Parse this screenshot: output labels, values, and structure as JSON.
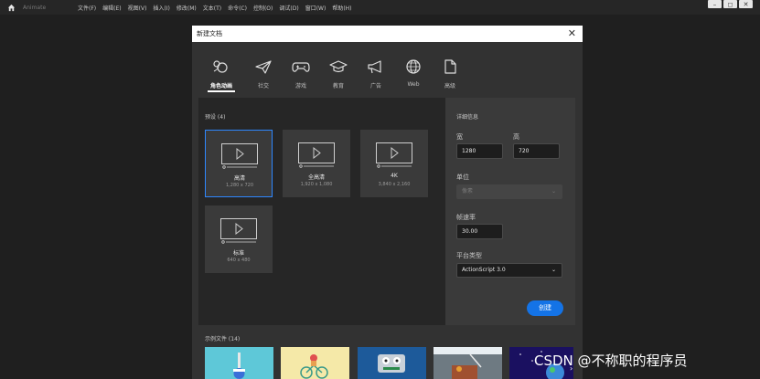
{
  "app": {
    "name": "Animate",
    "menus": [
      "文件(F)",
      "编辑(E)",
      "视图(V)",
      "插入(I)",
      "修改(M)",
      "文本(T)",
      "命令(C)",
      "控制(O)",
      "调试(D)",
      "窗口(W)",
      "帮助(H)"
    ],
    "window_controls": [
      "–",
      "◻",
      "✕"
    ]
  },
  "dialog": {
    "title": "新建文档",
    "tabs": [
      {
        "label": "角色动画",
        "icon": "character-animation-icon"
      },
      {
        "label": "社交",
        "icon": "paper-plane-icon"
      },
      {
        "label": "游戏",
        "icon": "gamepad-icon"
      },
      {
        "label": "教育",
        "icon": "graduation-cap-icon"
      },
      {
        "label": "广告",
        "icon": "megaphone-icon"
      },
      {
        "label": "Web",
        "icon": "globe-icon"
      },
      {
        "label": "高级",
        "icon": "document-icon"
      }
    ],
    "presets": {
      "title": "预设 (4)",
      "items": [
        {
          "name": "高清",
          "dims": "1,280 x 720"
        },
        {
          "name": "全高清",
          "dims": "1,920 x 1,080"
        },
        {
          "name": "4K",
          "dims": "3,840 x 2,160"
        },
        {
          "name": "标准",
          "dims": "640 x 480"
        }
      ]
    },
    "details": {
      "title": "详细信息",
      "width_label": "宽",
      "width_value": "1280",
      "height_label": "高",
      "height_value": "720",
      "unit_label": "单位",
      "unit_value": "像素",
      "fps_label": "帧速率",
      "fps_value": "30.00",
      "platform_label": "平台类型",
      "platform_value": "ActionScript 3.0",
      "create_label": "创建"
    },
    "examples": {
      "title": "示例文件 (14)"
    }
  },
  "watermark": "CSDN @不称职的程序员"
}
